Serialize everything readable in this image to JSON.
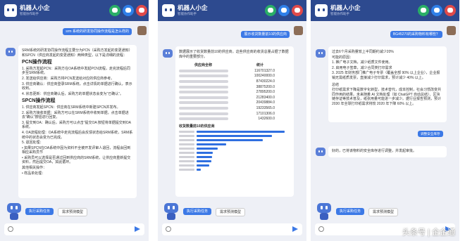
{
  "app": {
    "title": "机器人小企",
    "subtitle": "智能协作助手"
  },
  "panel1": {
    "user_msg": "srm 系统的研发协同操作流程是怎么样的",
    "intro": "SRM系统的研发协同操作流程主要分为PCN（采购方发起的变更通知）和SPCN（供应商发起的变更通知）两种类型，以下是详细的流程：",
    "pcn_title": "PCN操作流程",
    "pcn_steps": [
      "1. 采购方发起PCN：采购方在OA系统中发起PCN流程，走完流程后同步至SRM系统。",
      "2. 发送给供应商：采购方将PCN发送给对应的供应商参考。",
      "3. 供应商确认：供应商登录SRM系统，点击详情的单据进行确认，表示收到。",
      "4. 状态更新：供应商确认后，采购方的单据状态会变为“已确认”。"
    ],
    "spcn_title": "SPCN操作流程",
    "spcn_steps": [
      "1. 供应商发起SPCN：供应商在SRM系统中新建SPCN并发布。",
      "2. 采购方接收单据：采购方可以在SRM系统中收到单据，点击单据进去“确认”按钮进行回复。",
      "3. 提交到OA：确认后，采购方可以点击“提交OA 按钮将单据提交到OA系统。",
      "4. OA流程处理：OA系统中走完流程后会反馈状态给SRM系统，SRM系统中的状态会变为已完成。",
      "5. 退回处理：",
      "• 如果SPCN在OA系统中因为资料不全被开发评审人退回，流程会回到相应采购员节",
      "• 采购员可以选择是否通过回到供应商的SRM系统，让供应商重新提交资料，然后提交OA，如此循环。",
      "其他相关操作：",
      "• 样品单处理："
    ]
  },
  "panel2": {
    "user_msg": "展示收货数量前10的供应商",
    "intro": "数据展示了收货数量前10的供应商。这些供应商的收货总量占据了数据库中的重要部分。",
    "table_headers": {
      "name": "供应商全称",
      "value": "统计"
    },
    "table_values": [
      "116701327.0",
      "100240000.0",
      "87430224.0",
      "38875200.0",
      "27895200.0",
      "21283400.0",
      "20439884.0",
      "19233565.0",
      "17101306.0",
      "1432600.0"
    ],
    "chart_title": "收货数量前10的供应商"
  },
  "panel3": {
    "user_msg": "BG45270的采购物料有哪些？",
    "answer_lines": [
      "过去6个月采购量较上半同期约减少20%",
      "可能的原因：",
      "1. 推广电子文档，减少纸质文件使用。",
      "2. 启用电子签章，减少合同类打印需求",
      "3. 2025 年财务部门推广电子专票（覆盖全部 90% 以上企业），企业报销无需纸质发票，直接减少打印需求，预计减少 40% 以上。",
      "总结",
      "打印纸需求下降是数字化转型，技术替代，成本控制，社会习惯改变共同作用的结果。未来随着 AI 文档处理（如 ChatGPT 自动总结）、区块链存证等技术普及，纸张用量可能进一步减少。据行业报告预测，预计 2030 年全球打印纸需求将较 2020 年下降 60% 以上。"
    ],
    "action_button": "调整安全库存",
    "reply": "好的，已将该物料的安全库存进行调整，并发起审批。"
  },
  "chips": {
    "primary": "执行采购任务",
    "secondary": "需求预测模型"
  },
  "watermark": "头条号 | 企企通"
}
